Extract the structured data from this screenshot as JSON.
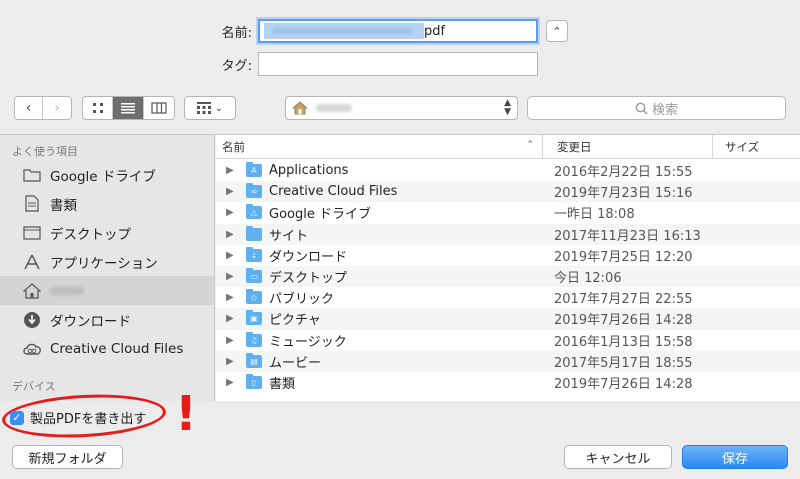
{
  "form": {
    "name_label": "名前:",
    "name_value_ext": "pdf",
    "tag_label": "タグ:",
    "tag_value": ""
  },
  "toolbar": {
    "back_icon": "‹",
    "forward_icon": "›",
    "location_folder": "",
    "search_placeholder": "検索"
  },
  "sidebar": {
    "favorites_header": "よく使う項目",
    "devices_header": "デバイス",
    "items": [
      {
        "label": "Google ドライブ",
        "icon": "folder-icon"
      },
      {
        "label": "書類",
        "icon": "document-icon"
      },
      {
        "label": "デスクトップ",
        "icon": "desktop-icon"
      },
      {
        "label": "アプリケーション",
        "icon": "applications-icon"
      },
      {
        "label": "",
        "icon": "home-icon"
      },
      {
        "label": "ダウンロード",
        "icon": "download-icon"
      },
      {
        "label": "Creative Cloud Files",
        "icon": "creative-cloud-icon"
      }
    ]
  },
  "columns": {
    "name": "名前",
    "date": "変更日",
    "size": "サイズ"
  },
  "files": [
    {
      "name": "Applications",
      "date": "2016年2月22日 15:55",
      "glyph": "A"
    },
    {
      "name": "Creative Cloud Files",
      "date": "2019年7月23日 15:16",
      "glyph": "∞"
    },
    {
      "name": "Google ドライブ",
      "date": "一昨日 18:08",
      "glyph": "△"
    },
    {
      "name": "サイト",
      "date": "2017年11月23日 16:13",
      "glyph": ""
    },
    {
      "name": "ダウンロード",
      "date": "2019年7月25日 12:20",
      "glyph": "↓"
    },
    {
      "name": "デスクトップ",
      "date": "今日 12:06",
      "glyph": "▭"
    },
    {
      "name": "パブリック",
      "date": "2017年7月27日 22:55",
      "glyph": "◇"
    },
    {
      "name": "ピクチャ",
      "date": "2019年7月26日 14:28",
      "glyph": "▣"
    },
    {
      "name": "ミュージック",
      "date": "2016年1月13日 15:58",
      "glyph": "♫"
    },
    {
      "name": "ムービー",
      "date": "2017年5月17日 18:55",
      "glyph": "▤"
    },
    {
      "name": "書類",
      "date": "2019年7月26日 14:28",
      "glyph": "▯"
    }
  ],
  "bottom": {
    "checkbox_label": "製品PDFを書き出す",
    "checkbox_checked": true,
    "annotation_mark": "!",
    "new_folder_label": "新規フォルダ",
    "cancel_label": "キャンセル",
    "save_label": "保存"
  },
  "colors": {
    "accent": "#2a8af2",
    "annotation": "#e81b1b",
    "folder": "#5fb0ee"
  }
}
